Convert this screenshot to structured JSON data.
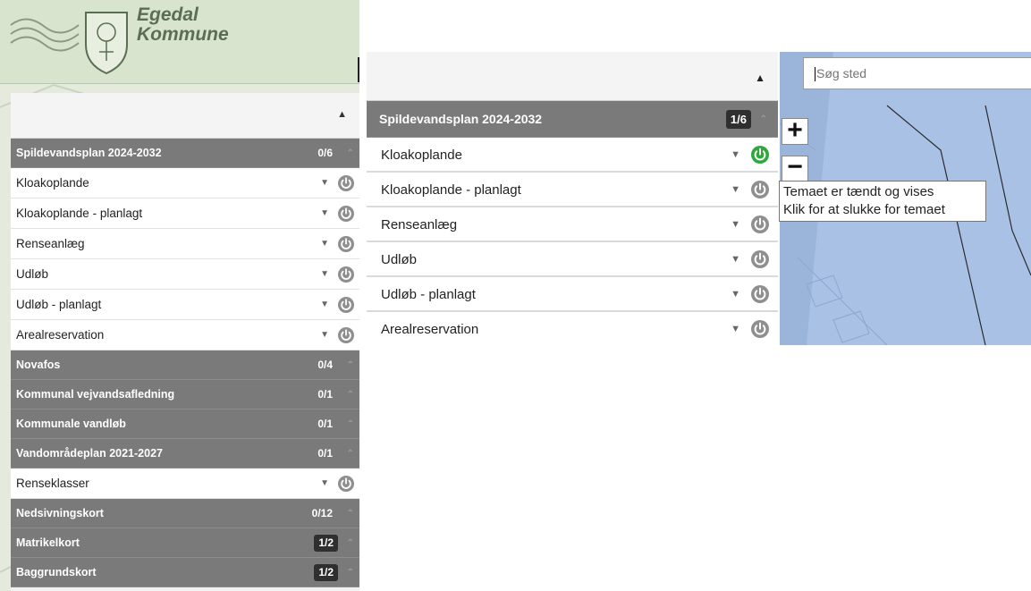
{
  "brand": {
    "line1": "Egedal",
    "line2": "Kommune"
  },
  "colors": {
    "group_bg": "#7a7a7a",
    "power_off": "#8f8f8f",
    "power_on": "#2ea83a",
    "map_water": "#a8c1e5"
  },
  "icons": {
    "collapse": "▲",
    "dropdown": "▼",
    "group_chevron": "⌃"
  },
  "left": {
    "groups": [
      {
        "title": "Spildevandsplan 2024-2032",
        "count": "0/6",
        "expanded": true,
        "layers": [
          "Kloakoplande",
          "Kloakoplande - planlagt",
          "Renseanlæg",
          "Udløb",
          "Udløb - planlagt",
          "Arealreservation"
        ]
      },
      {
        "title": "Novafos",
        "count": "0/4",
        "expanded": false,
        "layers": []
      },
      {
        "title": "Kommunal vejvandsafledning",
        "count": "0/1",
        "expanded": false,
        "layers": []
      },
      {
        "title": "Kommunale vandløb",
        "count": "0/1",
        "expanded": false,
        "layers": []
      },
      {
        "title": "Vandområdeplan 2021-2027",
        "count": "0/1",
        "expanded": true,
        "layers": [
          "Renseklasser"
        ]
      },
      {
        "title": "Nedsivningskort",
        "count": "0/12",
        "expanded": false,
        "layers": []
      },
      {
        "title": "Matrikelkort",
        "count": "1/2",
        "boxed": true,
        "expanded": false,
        "layers": []
      },
      {
        "title": "Baggrundskort",
        "count": "1/2",
        "boxed": true,
        "expanded": false,
        "layers": []
      }
    ]
  },
  "right": {
    "group": {
      "title": "Spildevandsplan 2024-2032",
      "count": "1/6"
    },
    "layers": [
      {
        "label": "Kloakoplande",
        "on": true
      },
      {
        "label": "Kloakoplande - planlagt",
        "on": false
      },
      {
        "label": "Renseanlæg",
        "on": false
      },
      {
        "label": "Udløb",
        "on": false
      },
      {
        "label": "Udløb - planlagt",
        "on": false
      },
      {
        "label": "Arealreservation",
        "on": false
      }
    ],
    "search": {
      "placeholder": "Søg sted"
    },
    "zoom": {
      "in": "+",
      "out": "−"
    },
    "tooltip": {
      "line1": "Temaet er tændt og vises",
      "line2": "Klik for at slukke for temaet"
    }
  }
}
